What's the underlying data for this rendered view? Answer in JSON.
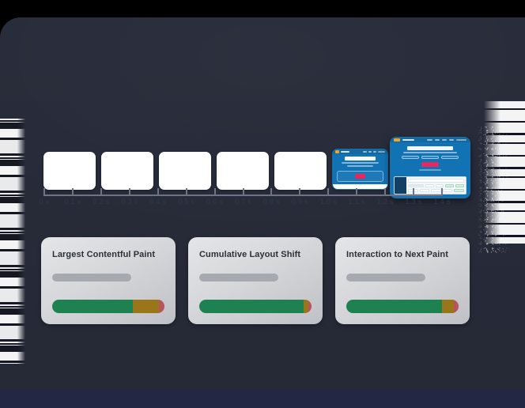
{
  "theme": {
    "page_bg": "#282c3a",
    "outer_bg": "#000000",
    "bottom_band": "#232744",
    "axis_color": "#6c7486",
    "card_text": "#2b2f38",
    "good": "#1d8250",
    "needs_improvement": "#99761a",
    "poor": "#b8545c",
    "brand_blue": "#1273b4",
    "brand_pink": "#e8275f",
    "brand_orange": "#f0a32b"
  },
  "filmstrip": {
    "blank_frame_count": 5,
    "frames": [
      {
        "label": "frame-0.0s",
        "state": "blank"
      },
      {
        "label": "frame-0.1s",
        "state": "blank"
      },
      {
        "label": "frame-0.2s",
        "state": "blank"
      },
      {
        "label": "frame-0.3s",
        "state": "blank"
      },
      {
        "label": "frame-0.4s",
        "state": "blank"
      },
      {
        "label": "frame-partial",
        "state": "partial"
      },
      {
        "label": "frame-complete",
        "state": "complete"
      }
    ],
    "thumbnail": {
      "headline": "Monitor Page Speed and Core Web Vitals",
      "subline": "Track your site performance and get alerted when your Core Web Vitals change",
      "cta_label": "Start Free Trial",
      "note": "No credit card required",
      "chips": [
        "Real User Data",
        "Lab Testing",
        "Alerts"
      ],
      "nav_links": [
        "Tour",
        "Pricing",
        "Docs",
        "Blog",
        "Log in"
      ],
      "nav_cta": "Sign up"
    }
  },
  "axis": {
    "unit_suffix": "s",
    "ticks": [
      "0 s",
      "0.1 s",
      "0.2 s",
      "0.3 s",
      "0.4 s",
      "0.5 s",
      "0.6 s",
      "0.7 s",
      "0.8 s",
      "0.9 s",
      "1.0 s",
      "1.1 s",
      "1.2 s",
      "1.3 s",
      "1.4 s"
    ],
    "min": 0,
    "max": 1.4,
    "step": 0.1
  },
  "metrics": [
    {
      "id": "lcp",
      "title": "Largest Contentful Paint",
      "value_loading": true,
      "distribution": {
        "good": 72,
        "needs_improvement": 23,
        "poor": 5
      }
    },
    {
      "id": "cls",
      "title": "Cumulative Layout Shift",
      "value_loading": true,
      "distribution": {
        "good": 93,
        "needs_improvement": 4,
        "poor": 3
      }
    },
    {
      "id": "inp",
      "title": "Interaction to Next Paint",
      "value_loading": true,
      "distribution": {
        "good": 85,
        "needs_improvement": 11,
        "poor": 4
      }
    }
  ]
}
